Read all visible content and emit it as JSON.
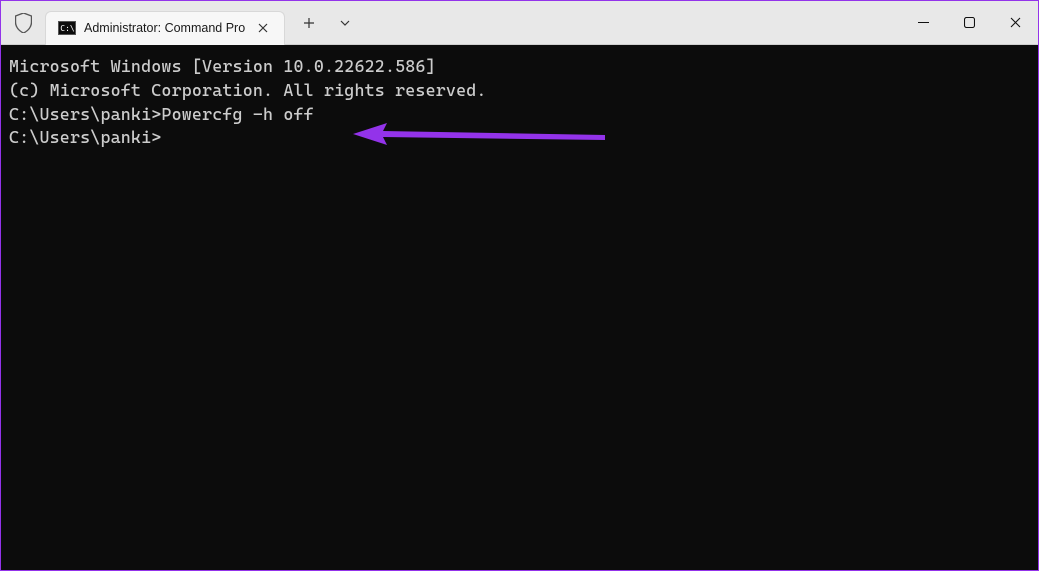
{
  "window": {
    "tab_title": "Administrator: Command Pro"
  },
  "terminal": {
    "line1": "Microsoft Windows [Version 10.0.22622.586]",
    "line2": "(c) Microsoft Corporation. All rights reserved.",
    "blank1": "",
    "prompt1_path": "C:\\Users\\panki>",
    "prompt1_cmd": "Powercfg -h off",
    "blank2": "",
    "prompt2_path": "C:\\Users\\panki>",
    "prompt2_cmd": ""
  },
  "annotation": {
    "color": "#9333ea"
  }
}
